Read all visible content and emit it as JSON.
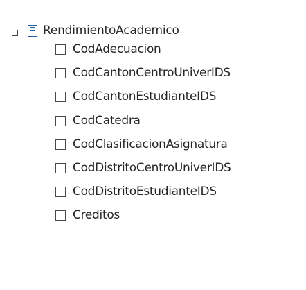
{
  "tree": {
    "root_label": "RendimientoAcademico",
    "root_icon": "table-icon",
    "collapse_icon": "collapse-icon",
    "fields": [
      {
        "label": "CodAdecuacion",
        "checked": false
      },
      {
        "label": "CodCantonCentroUniverIDS",
        "checked": false
      },
      {
        "label": "CodCantonEstudianteIDS",
        "checked": false
      },
      {
        "label": "CodCatedra",
        "checked": false
      },
      {
        "label": "CodClasificacionAsignatura",
        "checked": false
      },
      {
        "label": "CodDistritoCentroUniverIDS",
        "checked": false
      },
      {
        "label": "CodDistritoEstudianteIDS",
        "checked": false
      },
      {
        "label": "Creditos",
        "checked": false
      }
    ]
  },
  "colors": {
    "icon_accent": "#1f5fa8",
    "text": "#262626",
    "checkbox_border": "#4a4a4a"
  }
}
